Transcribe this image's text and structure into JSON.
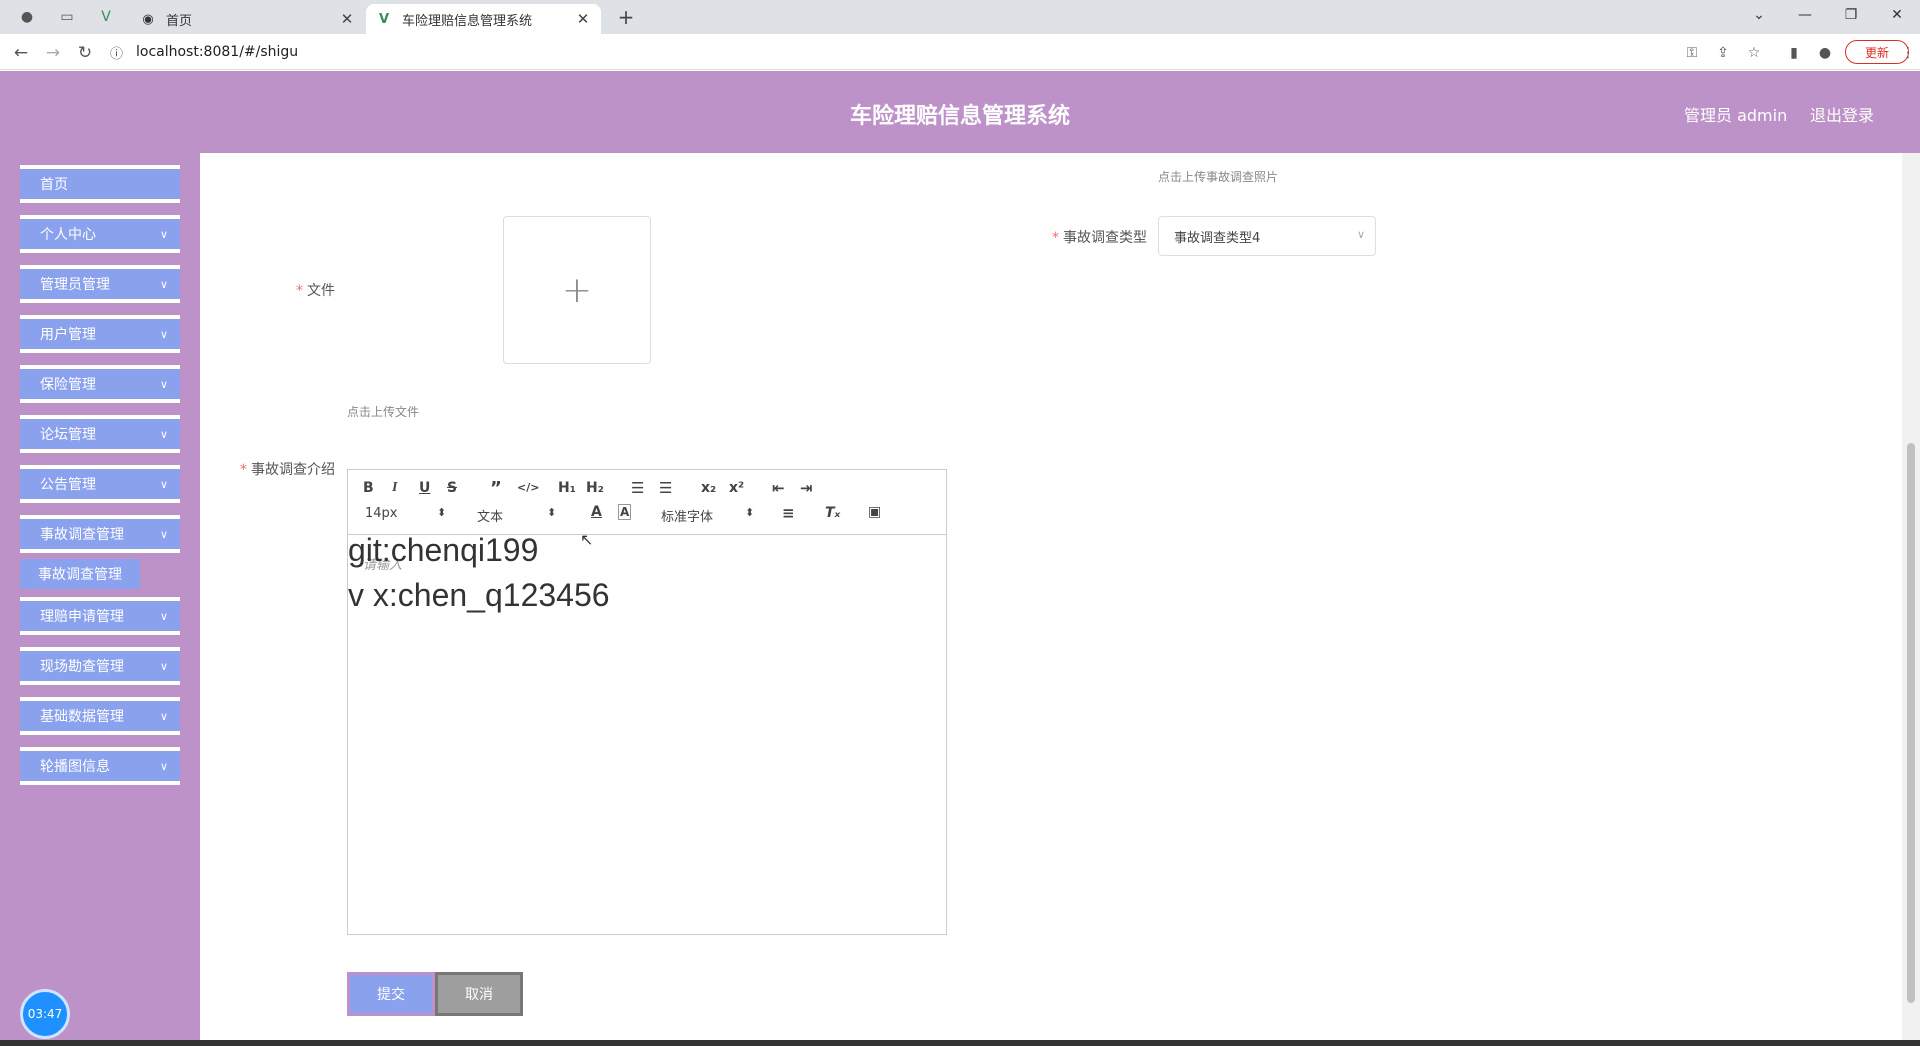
{
  "browser": {
    "tabs": [
      {
        "label": "首页"
      },
      {
        "label": "车险理赔信息管理系统"
      }
    ],
    "url": "localhost:8081/#/shigu",
    "update_label": "更新"
  },
  "header": {
    "title": "车险理赔信息管理系统",
    "user": "管理员 admin",
    "logout": "退出登录"
  },
  "sidebar": {
    "items": [
      {
        "label": "首页"
      },
      {
        "label": "个人中心"
      },
      {
        "label": "管理员管理"
      },
      {
        "label": "用户管理"
      },
      {
        "label": "保险管理"
      },
      {
        "label": "论坛管理"
      },
      {
        "label": "公告管理"
      },
      {
        "label": "事故调查管理"
      },
      {
        "label": "理赔申请管理"
      },
      {
        "label": "现场勘查管理"
      },
      {
        "label": "基础数据管理"
      },
      {
        "label": "轮播图信息"
      }
    ],
    "active_submenu": "事故调查管理",
    "clock": "03:47"
  },
  "form": {
    "photo_hint": "点击上传事故调查照片",
    "file_label": "文件",
    "file_hint": "点击上传文件",
    "type_label": "事故调查类型",
    "type_value": "事故调查类型4",
    "intro_label": "事故调查介绍",
    "required_mark": "*"
  },
  "editor": {
    "font_size": "14px",
    "block_format": "文本",
    "font_family": "标准字体",
    "placeholder": "请输入",
    "lines": [
      "git:chenqi199",
      "v x:chen_q123456"
    ]
  },
  "actions": {
    "submit": "提交",
    "cancel": "取消"
  }
}
